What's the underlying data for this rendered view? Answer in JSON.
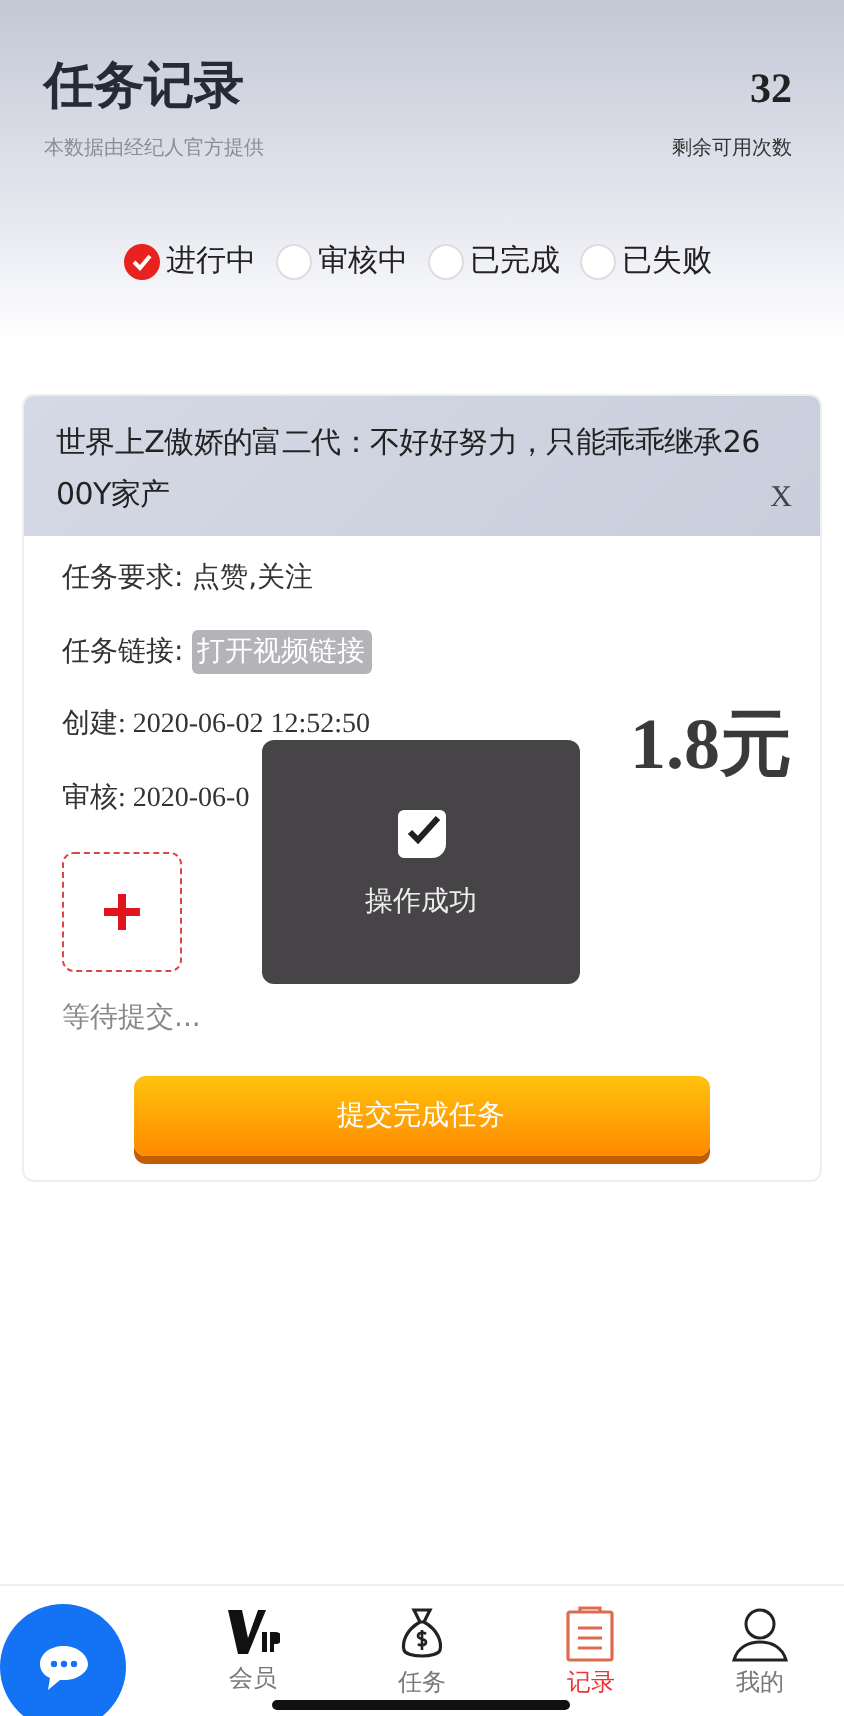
{
  "header": {
    "title": "任务记录",
    "subtitle": "本数据由经纪人官方提供",
    "count": "32",
    "count_label": "剩余可用次数"
  },
  "filters": [
    {
      "label": "进行中",
      "selected": true
    },
    {
      "label": "审核中",
      "selected": false
    },
    {
      "label": "已完成",
      "selected": false
    },
    {
      "label": "已失败",
      "selected": false
    }
  ],
  "task": {
    "title": "世界上Z傲娇的富二代：不好好努力，只能乖乖继承2600Y家产",
    "close": "X",
    "requirement": "任务要求: 点赞,关注",
    "link_label": "任务链接:",
    "link": "打开视频链接",
    "created": "创建: 2020-06-02 12:52:50",
    "reviewed": "审核: 2020-06-0",
    "reward": "1.8元",
    "upload_status": "等待提交...",
    "submit": "提交完成任务"
  },
  "toast": {
    "message": "操作成功"
  },
  "nav": [
    {
      "label": "会员",
      "kind": "vip",
      "selected": false
    },
    {
      "label": "任务",
      "kind": "money",
      "selected": false
    },
    {
      "label": "记录",
      "kind": "clipboard",
      "selected": true
    },
    {
      "label": "我的",
      "kind": "person",
      "selected": false
    }
  ]
}
